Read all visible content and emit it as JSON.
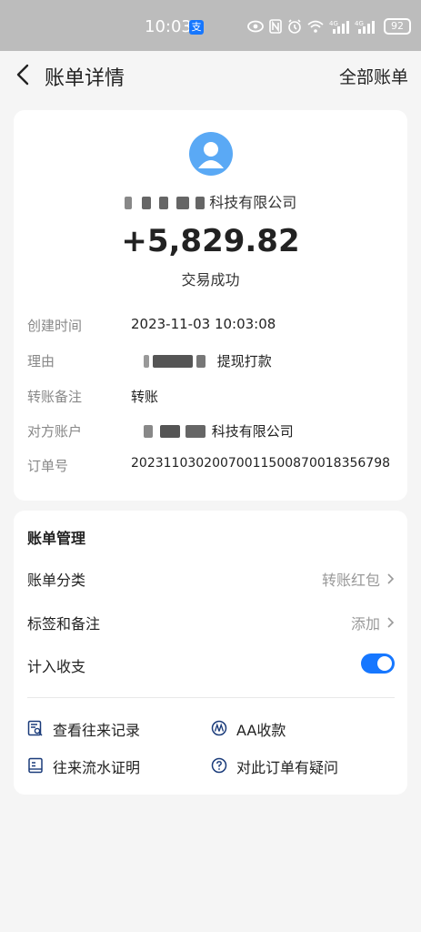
{
  "status_bar": {
    "time": "10:03",
    "app_icon_glyph": "支",
    "battery": "92",
    "icons": [
      "eye-icon",
      "nfc-icon",
      "alarm-icon",
      "wifi-icon",
      "4g-signal-icon",
      "4g-signal-icon"
    ]
  },
  "nav": {
    "title": "账单详情",
    "right_link": "全部账单"
  },
  "bill": {
    "merchant_suffix": "科技有限公司",
    "amount": "+5,829.82",
    "status": "交易成功",
    "details": [
      {
        "label": "创建时间",
        "value": "2023-11-03 10:03:08"
      },
      {
        "label": "理由",
        "value": "提现打款"
      },
      {
        "label": "转账备注",
        "value": "转账"
      },
      {
        "label": "对方账户",
        "value": "科技有限公司"
      },
      {
        "label": "订单号",
        "value": "20231103020070011500870018356798"
      }
    ]
  },
  "management": {
    "title": "账单管理",
    "category_label": "账单分类",
    "category_value": "转账红包",
    "tags_label": "标签和备注",
    "tags_value": "添加",
    "count_label": "计入收支",
    "count_enabled": true,
    "actions": [
      {
        "label": "查看往来记录",
        "icon": "history-icon"
      },
      {
        "label": "AA收款",
        "icon": "aa-icon"
      },
      {
        "label": "往来流水证明",
        "icon": "statement-icon"
      },
      {
        "label": "对此订单有疑问",
        "icon": "question-icon"
      }
    ]
  },
  "colors": {
    "accent": "#1677ff",
    "avatar": "#5aa9f5",
    "background": "#f5f5f5"
  }
}
